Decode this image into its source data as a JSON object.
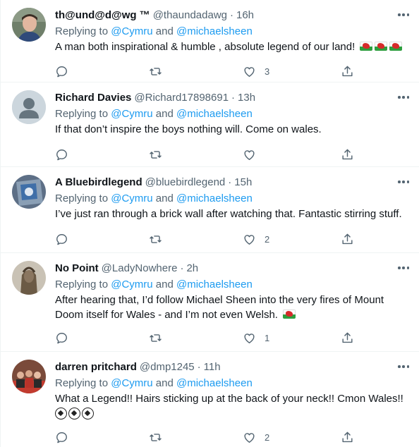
{
  "tweets": [
    {
      "name": "th@und@d@wg ™",
      "handle": "@thaundadawg",
      "time": "16h",
      "replying_prefix": "Replying to ",
      "mention_1": "@Cymru",
      "and_word": " and ",
      "mention_2": "@michaelsheen",
      "text": "A man both inspirational & humble , absolute legend of our land!",
      "emoji": [
        "welsh-flag",
        "welsh-flag",
        "welsh-flag"
      ],
      "likes": "3",
      "avatar": "person-photo"
    },
    {
      "name": "Richard Davies",
      "handle": "@Richard17898691",
      "time": "13h",
      "replying_prefix": "Replying to ",
      "mention_1": "@Cymru",
      "and_word": " and ",
      "mention_2": "@michaelsheen",
      "text": "If that don’t inspire the boys nothing will. Come on wales.",
      "emoji": [],
      "likes": "",
      "avatar": "default-avatar"
    },
    {
      "name": "A Bluebirdlegend",
      "handle": "@bluebirdlegend",
      "time": "15h",
      "replying_prefix": "Replying to ",
      "mention_1": "@Cymru",
      "and_word": " and ",
      "mention_2": "@michaelsheen",
      "text": "I’ve just ran through a brick wall after watching that. Fantastic stirring stuff.",
      "emoji": [],
      "likes": "2",
      "avatar": "bluebird-crest"
    },
    {
      "name": "No Point",
      "handle": "@LadyNowhere",
      "time": "2h",
      "replying_prefix": "Replying to ",
      "mention_1": "@Cymru",
      "and_word": " and ",
      "mention_2": "@michaelsheen",
      "text": "After hearing that, I’d follow Michael Sheen into the very fires of Mount Doom itself for Wales - and I’m not even Welsh.",
      "emoji": [
        "welsh-flag"
      ],
      "likes": "1",
      "avatar": "statue-photo"
    },
    {
      "name": "darren pritchard",
      "handle": "@dmp1245",
      "time": "11h",
      "replying_prefix": "Replying to ",
      "mention_1": "@Cymru",
      "and_word": " and ",
      "mention_2": "@michaelsheen",
      "text": "What a Legend!! Hairs sticking up at the back of your neck!! Cmon Wales!!",
      "emoji_line": [
        "soccer-ball",
        "soccer-ball",
        "soccer-ball"
      ],
      "likes": "2",
      "avatar": "group-photo"
    }
  ],
  "colors": {
    "mention": "#1d9bf0",
    "secondary_text": "#536471",
    "primary_text": "#0f1419",
    "divider": "#eff3f4"
  }
}
